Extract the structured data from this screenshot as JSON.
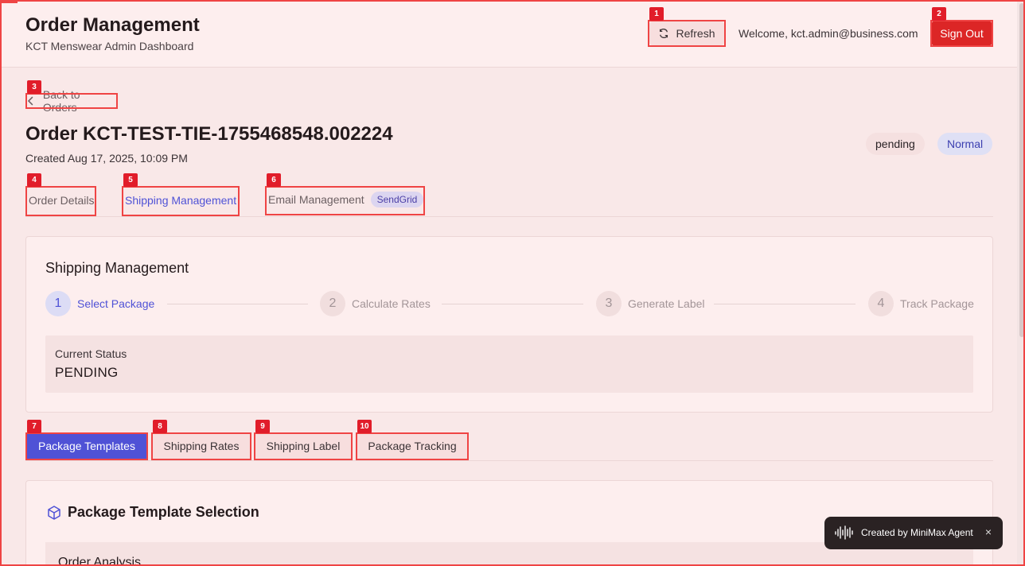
{
  "header": {
    "title": "Order Management",
    "subtitle": "KCT Menswear Admin Dashboard",
    "refresh_label": "Refresh",
    "welcome_text": "Welcome, kct.admin@business.com",
    "signout_label": "Sign Out"
  },
  "annotations": [
    "1",
    "2",
    "3",
    "4",
    "5",
    "6",
    "7",
    "8",
    "9",
    "10"
  ],
  "order": {
    "back_label": "Back to Orders",
    "title": "Order KCT-TEST-TIE-1755468548.002224",
    "created": "Created Aug 17, 2025, 10:09 PM",
    "status_badge": "pending",
    "priority_badge": "Normal"
  },
  "tabs": [
    {
      "label": "Order Details",
      "active": false
    },
    {
      "label": "Shipping Management",
      "active": true
    },
    {
      "label": "Email Management",
      "active": false,
      "badge": "SendGrid"
    }
  ],
  "shipping": {
    "title": "Shipping Management",
    "steps": [
      {
        "num": "1",
        "label": "Select Package",
        "active": true
      },
      {
        "num": "2",
        "label": "Calculate Rates",
        "active": false
      },
      {
        "num": "3",
        "label": "Generate Label",
        "active": false
      },
      {
        "num": "4",
        "label": "Track Package",
        "active": false
      }
    ],
    "status_label": "Current Status",
    "status_value": "PENDING"
  },
  "subtabs": [
    {
      "label": "Package Templates",
      "active": true
    },
    {
      "label": "Shipping Rates",
      "active": false
    },
    {
      "label": "Shipping Label",
      "active": false
    },
    {
      "label": "Package Tracking",
      "active": false
    }
  ],
  "package": {
    "title": "Package Template Selection",
    "analysis_title": "Order Analysis",
    "icon": "package-icon"
  },
  "toast": {
    "text": "Created by MiniMax Agent",
    "close": "×"
  },
  "colors": {
    "accent": "#4f52d6",
    "danger": "#dc2626",
    "annotation": "#ef4444",
    "background": "#f9e8e8"
  }
}
